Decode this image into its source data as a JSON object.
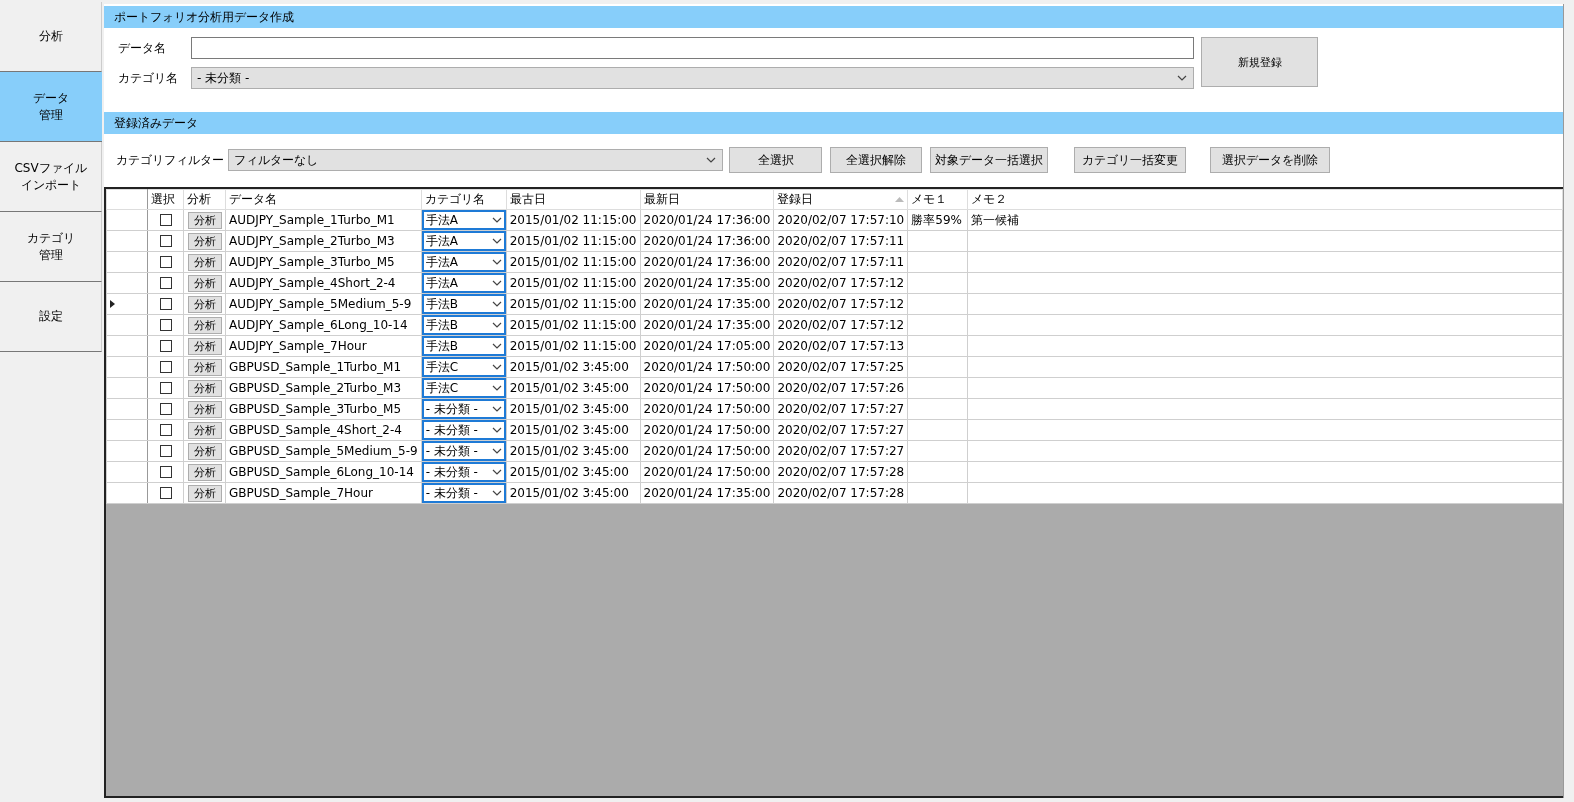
{
  "sidebar": {
    "items": [
      {
        "label": "分析",
        "selected": false
      },
      {
        "lines": [
          "データ",
          "管理"
        ],
        "selected": true
      },
      {
        "lines": [
          "CSVファイル",
          "インポート"
        ],
        "selected": false
      },
      {
        "lines": [
          "カテゴリ",
          "管理"
        ],
        "selected": false
      },
      {
        "label": "設定",
        "selected": false
      }
    ]
  },
  "create_section": {
    "title": "ポートフォリオ分析用データ作成",
    "data_name_label": "データ名",
    "category_label": "カテゴリ名",
    "category_value": "- 未分類 -",
    "register_button": "新規登録"
  },
  "registered_section": {
    "title": "登録済みデータ",
    "filter_label": "カテゴリフィルター",
    "filter_value": "フィルターなし",
    "buttons": [
      "全選択",
      "全選択解除",
      "対象データ一括選択",
      "カテゴリ一括変更",
      "選択データを削除"
    ]
  },
  "table": {
    "columns": [
      {
        "label": "選択",
        "sorted": false
      },
      {
        "label": "分析",
        "sorted": false
      },
      {
        "label": "データ名",
        "sorted": false
      },
      {
        "label": "カテゴリ名",
        "sorted": false
      },
      {
        "label": "最古日",
        "sorted": false
      },
      {
        "label": "最新日",
        "sorted": false
      },
      {
        "label": "登録日",
        "sorted": true
      },
      {
        "label": "メモ１",
        "sorted": false
      },
      {
        "label": "メモ２",
        "sorted": false
      }
    ],
    "rows": [
      {
        "current": false,
        "checked": false,
        "analyze_button": "分析",
        "name": "AUDJPY_Sample_1Turbo_M1",
        "category": "手法A",
        "oldest": "2015/01/02 11:15:00",
        "newest": "2020/01/24 17:36:00",
        "registered": "2020/02/07 17:57:10",
        "memo1": "勝率59%",
        "memo2": "第一候補"
      },
      {
        "current": false,
        "checked": false,
        "analyze_button": "分析",
        "name": "AUDJPY_Sample_2Turbo_M3",
        "category": "手法A",
        "oldest": "2015/01/02 11:15:00",
        "newest": "2020/01/24 17:36:00",
        "registered": "2020/02/07 17:57:11"
      },
      {
        "current": false,
        "checked": false,
        "analyze_button": "分析",
        "name": "AUDJPY_Sample_3Turbo_M5",
        "category": "手法A",
        "oldest": "2015/01/02 11:15:00",
        "newest": "2020/01/24 17:36:00",
        "registered": "2020/02/07 17:57:11"
      },
      {
        "current": false,
        "checked": false,
        "analyze_button": "分析",
        "name": "AUDJPY_Sample_4Short_2-4",
        "category": "手法A",
        "oldest": "2015/01/02 11:15:00",
        "newest": "2020/01/24 17:35:00",
        "registered": "2020/02/07 17:57:12"
      },
      {
        "current": true,
        "checked": false,
        "analyze_button": "分析",
        "name": "AUDJPY_Sample_5Medium_5-9",
        "category": "手法B",
        "oldest": "2015/01/02 11:15:00",
        "newest": "2020/01/24 17:35:00",
        "registered": "2020/02/07 17:57:12"
      },
      {
        "current": false,
        "checked": false,
        "analyze_button": "分析",
        "name": "AUDJPY_Sample_6Long_10-14",
        "category": "手法B",
        "oldest": "2015/01/02 11:15:00",
        "newest": "2020/01/24 17:35:00",
        "registered": "2020/02/07 17:57:12"
      },
      {
        "current": false,
        "checked": false,
        "analyze_button": "分析",
        "name": "AUDJPY_Sample_7Hour",
        "category": "手法B",
        "oldest": "2015/01/02 11:15:00",
        "newest": "2020/01/24 17:05:00",
        "registered": "2020/02/07 17:57:13"
      },
      {
        "current": false,
        "checked": false,
        "analyze_button": "分析",
        "name": "GBPUSD_Sample_1Turbo_M1",
        "category": "手法C",
        "oldest": "2015/01/02 3:45:00",
        "newest": "2020/01/24 17:50:00",
        "registered": "2020/02/07 17:57:25"
      },
      {
        "current": false,
        "checked": false,
        "analyze_button": "分析",
        "name": "GBPUSD_Sample_2Turbo_M3",
        "category": "手法C",
        "oldest": "2015/01/02 3:45:00",
        "newest": "2020/01/24 17:50:00",
        "registered": "2020/02/07 17:57:26"
      },
      {
        "current": false,
        "checked": false,
        "analyze_button": "分析",
        "name": "GBPUSD_Sample_3Turbo_M5",
        "category": "- 未分類 -",
        "oldest": "2015/01/02 3:45:00",
        "newest": "2020/01/24 17:50:00",
        "registered": "2020/02/07 17:57:27"
      },
      {
        "current": false,
        "checked": false,
        "analyze_button": "分析",
        "name": "GBPUSD_Sample_4Short_2-4",
        "category": "- 未分類 -",
        "oldest": "2015/01/02 3:45:00",
        "newest": "2020/01/24 17:50:00",
        "registered": "2020/02/07 17:57:27"
      },
      {
        "current": false,
        "checked": false,
        "analyze_button": "分析",
        "name": "GBPUSD_Sample_5Medium_5-9",
        "category": "- 未分類 -",
        "oldest": "2015/01/02 3:45:00",
        "newest": "2020/01/24 17:50:00",
        "registered": "2020/02/07 17:57:27"
      },
      {
        "current": false,
        "checked": false,
        "analyze_button": "分析",
        "name": "GBPUSD_Sample_6Long_10-14",
        "category": "- 未分類 -",
        "oldest": "2015/01/02 3:45:00",
        "newest": "2020/01/24 17:50:00",
        "registered": "2020/02/07 17:57:28"
      },
      {
        "current": false,
        "checked": false,
        "analyze_button": "分析",
        "name": "GBPUSD_Sample_7Hour",
        "category": "- 未分類 -",
        "oldest": "2015/01/02 3:45:00",
        "newest": "2020/01/24 17:35:00",
        "registered": "2020/02/07 17:57:28"
      }
    ]
  }
}
